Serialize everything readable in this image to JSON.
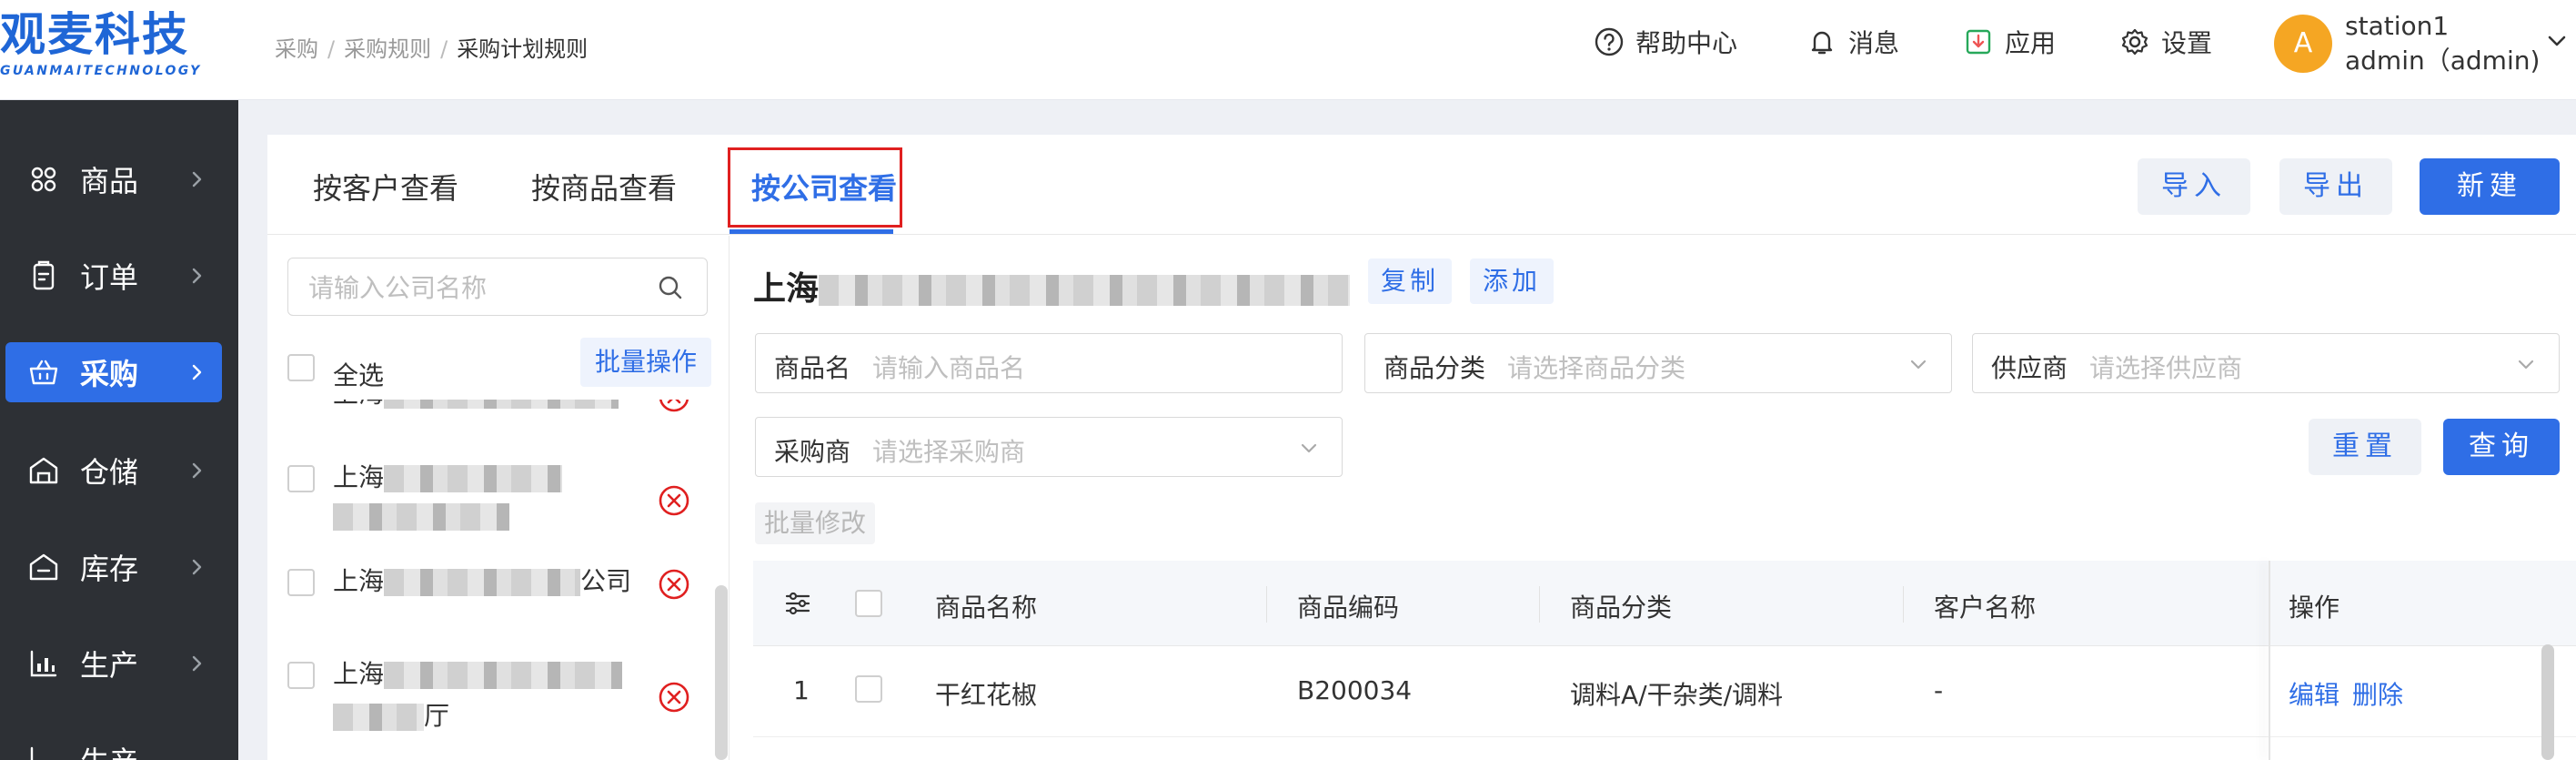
{
  "logo": {
    "cn": "观麦科技",
    "en": "GUANMAITECHNOLOGY"
  },
  "breadcrumb": [
    "采购",
    "采购规则",
    "采购计划规则"
  ],
  "header": {
    "help": "帮助中心",
    "messages": "消息",
    "apps": "应用",
    "settings": "设置",
    "avatar_letter": "A",
    "user_line1": "station1",
    "user_line2": "admin（admin)"
  },
  "sidebar": {
    "items": [
      {
        "label": "商品",
        "icon": "grid-icon"
      },
      {
        "label": "订单",
        "icon": "order-icon"
      },
      {
        "label": "采购",
        "icon": "basket-icon",
        "active": true
      },
      {
        "label": "仓储",
        "icon": "warehouse-icon"
      },
      {
        "label": "库存",
        "icon": "inventory-icon"
      },
      {
        "label": "生产",
        "icon": "production-icon"
      },
      {
        "label": "生产",
        "icon": "plan-icon"
      }
    ]
  },
  "tabs": [
    "按客户查看",
    "按商品查看",
    "按公司查看"
  ],
  "active_tab": 2,
  "actions": {
    "import": "导入",
    "export": "导出",
    "create": "新建"
  },
  "left": {
    "search_placeholder": "请输入公司名称",
    "select_all": "全选",
    "batch": "批量操作",
    "items": [
      {
        "prefix": "上海",
        "suffix": ""
      },
      {
        "prefix": "上海",
        "suffix": ""
      },
      {
        "prefix": "上海",
        "suffix": "公司"
      },
      {
        "prefix": "上海",
        "suffix": "厅"
      }
    ]
  },
  "company": {
    "name_prefix": "上海",
    "copy": "复制",
    "add": "添加"
  },
  "filters": {
    "product_label": "商品名",
    "product_placeholder": "请输入商品名",
    "category_label": "商品分类",
    "category_placeholder": "请选择商品分类",
    "supplier_label": "供应商",
    "supplier_placeholder": "请选择供应商",
    "buyer_label": "采购商",
    "buyer_placeholder": "请选择采购商",
    "reset": "重置",
    "query": "查询",
    "batch_edit": "批量修改"
  },
  "table": {
    "columns": [
      "商品名称",
      "商品编码",
      "商品分类",
      "客户名称",
      "操作"
    ],
    "rows": [
      {
        "index": "1",
        "name": "干红花椒",
        "code": "B200034",
        "category": "调料A/干杂类/调料",
        "customer": "-",
        "edit": "编辑",
        "delete": "删除"
      }
    ]
  },
  "colors": {
    "primary": "#2f6ee6",
    "sidebar": "#2d3035",
    "danger": "#e02020",
    "avatar": "#f5a623"
  }
}
